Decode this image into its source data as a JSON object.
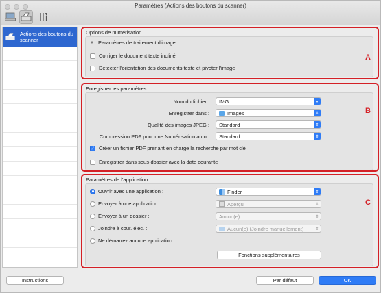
{
  "window": {
    "title": "Paramètres (Actions des boutons du scanner)"
  },
  "sidebar": {
    "items": [
      {
        "label": "Actions des boutons du scanner"
      }
    ]
  },
  "group_a": {
    "title": "Options de numérisation",
    "letter": "A",
    "subsection": "Paramètres de traitement d'image",
    "checkboxes": [
      {
        "label": "Corriger le document texte incliné",
        "checked": false
      },
      {
        "label": "Détecter l'orientation des documents texte et pivoter l'image",
        "checked": false
      }
    ]
  },
  "group_b": {
    "title": "Enregistrer les paramètres",
    "letter": "B",
    "fields": [
      {
        "label": "Nom du fichier :",
        "value": "IMG"
      },
      {
        "label": "Enregistrer dans :",
        "value": "Images"
      },
      {
        "label": "Qualité des images JPEG :",
        "value": "Standard"
      },
      {
        "label": "Compression PDF pour une Numérisation auto :",
        "value": "Standard"
      }
    ],
    "checkboxes": [
      {
        "label": "Créer un fichier PDF prenant en charge la recherche par mot clé",
        "checked": true
      },
      {
        "label": "Enregistrer dans sous-dossier avec la date courante",
        "checked": false
      }
    ]
  },
  "group_c": {
    "title": "Paramètres de l'application",
    "letter": "C",
    "options": [
      {
        "label": "Ouvrir avec une application :",
        "value": "Finder",
        "checked": true
      },
      {
        "label": "Envoyer à une application :",
        "value": "Aperçu",
        "checked": false
      },
      {
        "label": "Envoyer à un dossier :",
        "value": "Aucun(e)",
        "checked": false
      },
      {
        "label": "Joindre à cour. élec. :",
        "value": "Aucun(e) (Joindre manuellement)",
        "checked": false
      },
      {
        "label": "Ne démarrez aucune application",
        "checked": false
      }
    ],
    "more_button": "Fonctions supplémentaires"
  },
  "footer": {
    "instructions": "Instructions",
    "defaults": "Par défaut",
    "ok": "OK"
  },
  "colors": {
    "accent": "#2f7cf6",
    "highlight": "#d42026",
    "selection": "#2e67d0"
  }
}
